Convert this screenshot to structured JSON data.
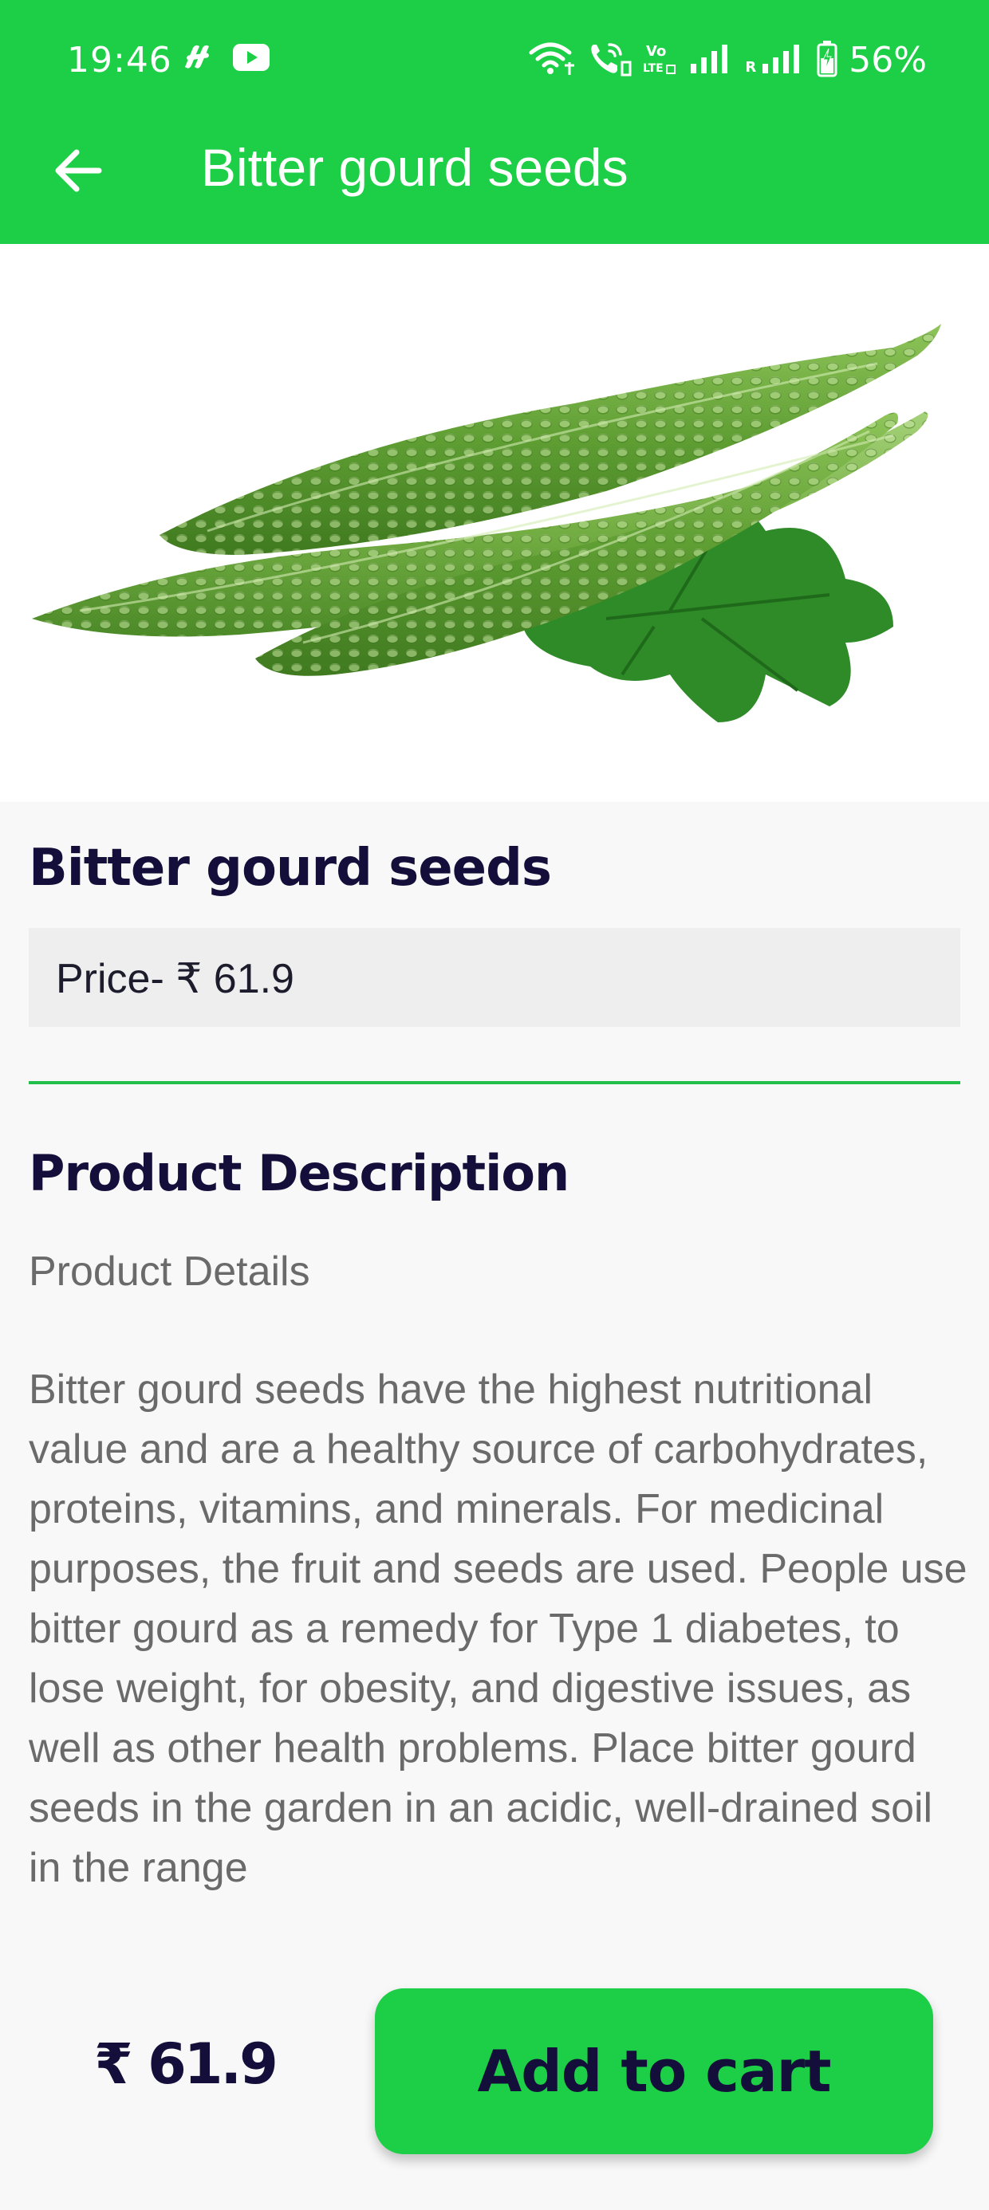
{
  "status_bar": {
    "time": "19:46",
    "battery_percent": "56%",
    "notification_icons": [
      "pinwheel-app-icon",
      "youtube-icon"
    ],
    "system_icons": [
      "wifi-icon",
      "wifi-calling-icon",
      "volte-icon",
      "signal-icon",
      "roaming-signal-icon",
      "battery-charging-icon"
    ],
    "volte_label": "Vo\nLTE",
    "roaming_label": "R"
  },
  "toolbar": {
    "title": "Bitter gourd seeds",
    "back_icon": "arrow-left-icon"
  },
  "product": {
    "image_alt": "Bitter gourd",
    "name": "Bitter gourd seeds",
    "price_label": "Price- ₹ 61.9"
  },
  "description": {
    "heading": "Product Description",
    "subheading": "Product Details",
    "body": "Bitter gourd seeds have the highest nutritional value and are a healthy source of carbohydrates, proteins, vitamins, and minerals. For medicinal purposes, the fruit and seeds are used. People use bitter gourd as a remedy for Type 1 diabetes, to lose weight, for obesity, and digestive issues, as well as other health problems. Place bitter gourd seeds in the garden in an acidic, well-drained soil in the range"
  },
  "bottom_bar": {
    "price": "₹ 61.9",
    "add_to_cart_label": "Add to cart"
  },
  "colors": {
    "brand_green": "#1ccf46",
    "divider_green": "#22c04a",
    "heading_navy": "#140f3a",
    "body_gray": "#6a6a6a",
    "background": "#f8f8f8",
    "price_box_bg": "#eeeeee"
  }
}
